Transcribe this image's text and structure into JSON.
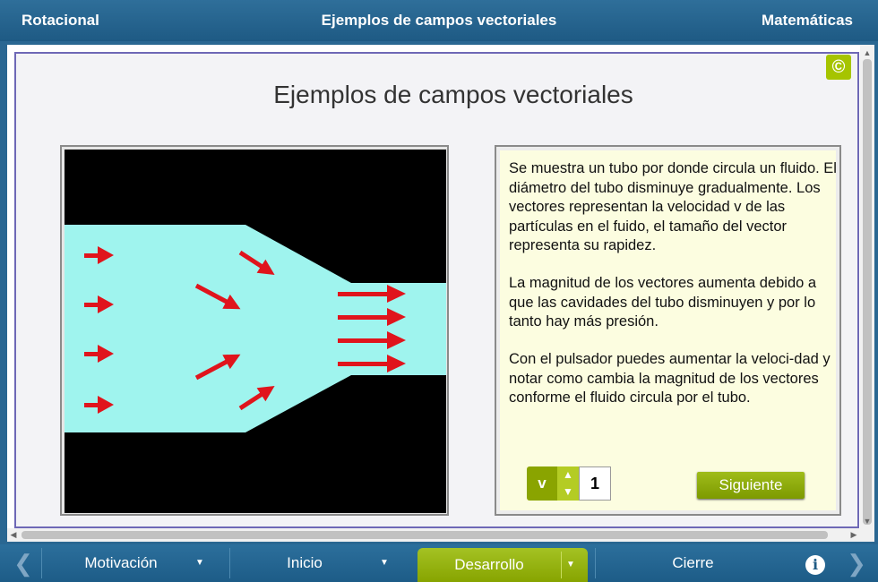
{
  "header": {
    "left": "Rotacional",
    "center": "Ejemplos de campos vectoriales",
    "right": "Matemáticas"
  },
  "copyright_icon": "copyright-icon",
  "main": {
    "title": "Ejemplos de campos vectoriales",
    "paragraph1": "Se muestra un tubo por donde circula un fluido. El diámetro del tubo disminuye gradualmente. Los vectores representan la velocidad  v  de las partículas en el fuido, el tamaño del vector representa su rapidez.",
    "paragraph2": "La magnitud de los vectores aumenta debido a que las cavidades del tubo disminuyen y por lo tanto hay más presión.",
    "paragraph3": "Con el pulsador puedes aumentar la veloci-dad y notar como cambia la magnitud de los vectores conforme el fluido circula por el tubo."
  },
  "controls": {
    "v_label": "v",
    "v_value": "1",
    "next_label": "Siguiente"
  },
  "nav": {
    "motivacion": "Motivación",
    "inicio": "Inicio",
    "desarrollo": "Desarrollo",
    "cierre": "Cierre",
    "info": "i"
  },
  "colors": {
    "header_bg": "#2a6792",
    "fluid": "#9ff4ee",
    "arrow": "#e0141c",
    "accent_green": "#8aa400",
    "panel_bg": "#fcfde0"
  },
  "arrows": [
    {
      "x1": 0,
      "y1": 0
    },
    {
      "x1": 0,
      "y1": 0
    }
  ]
}
